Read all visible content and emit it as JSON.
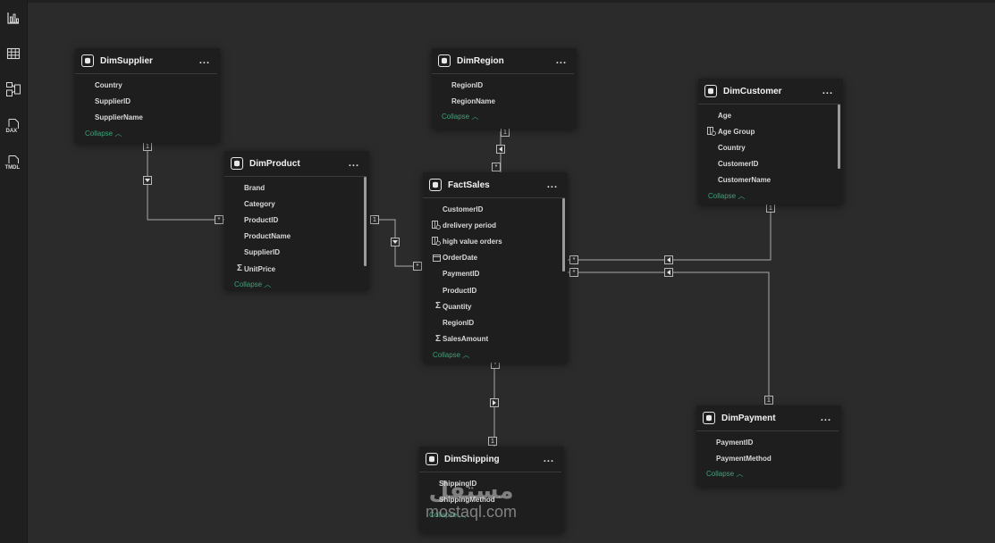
{
  "rail": {
    "items": [
      {
        "name": "report-view",
        "icon": "bar-chart-icon"
      },
      {
        "name": "table-view",
        "icon": "table-grid-icon"
      },
      {
        "name": "model-view",
        "icon": "model-diagram-icon"
      },
      {
        "name": "dax-query-view",
        "icon": "dax-icon",
        "label": "DAX"
      },
      {
        "name": "tmdl-view",
        "icon": "tmdl-icon",
        "label": "TMDL"
      }
    ]
  },
  "tables": {
    "dimsupplier": {
      "name": "DimSupplier",
      "more": "...",
      "collapse": "Collapse",
      "fields": [
        {
          "name": "Country",
          "icon": ""
        },
        {
          "name": "SupplierID",
          "icon": ""
        },
        {
          "name": "SupplierName",
          "icon": ""
        }
      ]
    },
    "dimregion": {
      "name": "DimRegion",
      "more": "...",
      "collapse": "Collapse",
      "fields": [
        {
          "name": "RegionID",
          "icon": ""
        },
        {
          "name": "RegionName",
          "icon": ""
        }
      ]
    },
    "dimcustomer": {
      "name": "DimCustomer",
      "more": "...",
      "collapse": "Collapse",
      "fields": [
        {
          "name": "Age",
          "icon": ""
        },
        {
          "name": "Age Group",
          "icon": "calculated-column-icon"
        },
        {
          "name": "Country",
          "icon": ""
        },
        {
          "name": "CustomerID",
          "icon": ""
        },
        {
          "name": "CustomerName",
          "icon": ""
        }
      ]
    },
    "dimproduct": {
      "name": "DimProduct",
      "more": "...",
      "collapse": "Collapse",
      "fields": [
        {
          "name": "Brand",
          "icon": ""
        },
        {
          "name": "Category",
          "icon": ""
        },
        {
          "name": "ProductID",
          "icon": ""
        },
        {
          "name": "ProductName",
          "icon": ""
        },
        {
          "name": "SupplierID",
          "icon": ""
        },
        {
          "name": "UnitPrice",
          "icon": "sigma-icon"
        }
      ]
    },
    "factsales": {
      "name": "FactSales",
      "more": "...",
      "collapse": "Collapse",
      "fields": [
        {
          "name": "CustomerID",
          "icon": ""
        },
        {
          "name": "drelivery period",
          "icon": "calculated-column-icon"
        },
        {
          "name": "high value orders",
          "icon": "calculated-column-icon"
        },
        {
          "name": "OrderDate",
          "icon": "calendar-icon"
        },
        {
          "name": "PaymentID",
          "icon": ""
        },
        {
          "name": "ProductID",
          "icon": ""
        },
        {
          "name": "Quantity",
          "icon": "sigma-icon"
        },
        {
          "name": "RegionID",
          "icon": ""
        },
        {
          "name": "SalesAmount",
          "icon": "sigma-icon"
        }
      ]
    },
    "dimpayment": {
      "name": "DimPayment",
      "more": "...",
      "collapse": "Collapse",
      "fields": [
        {
          "name": "PaymentID",
          "icon": ""
        },
        {
          "name": "PaymentMethod",
          "icon": ""
        }
      ]
    },
    "dimshipping": {
      "name": "DimShipping",
      "more": "...",
      "collapse": "Collapse",
      "fields": [
        {
          "name": "ShippingID",
          "icon": ""
        },
        {
          "name": "ShippingMethod",
          "icon": ""
        }
      ]
    }
  },
  "relationships": [
    {
      "from": "DimSupplier",
      "to": "DimProduct",
      "one": "1",
      "many": "*",
      "direction": "down"
    },
    {
      "from": "DimProduct",
      "to": "FactSales",
      "one": "1",
      "many": "*",
      "direction": "down"
    },
    {
      "from": "DimRegion",
      "to": "FactSales",
      "one": "1",
      "many": "*",
      "direction": "left"
    },
    {
      "from": "DimCustomer",
      "to": "FactSales",
      "one": "1",
      "many": "*",
      "direction": "left"
    },
    {
      "from": "DimPayment",
      "to": "FactSales",
      "one": "1",
      "many": "*",
      "direction": "left"
    },
    {
      "from": "DimShipping",
      "to": "FactSales",
      "one": "1",
      "many": "*",
      "direction": "right"
    }
  ],
  "watermark": {
    "arabic": "مستقل",
    "latin": "mostaql.com"
  },
  "colors": {
    "canvas": "#2b2b2b",
    "card": "#1e1e1e",
    "accent": "#3aa579",
    "line": "#a8a8a8"
  }
}
